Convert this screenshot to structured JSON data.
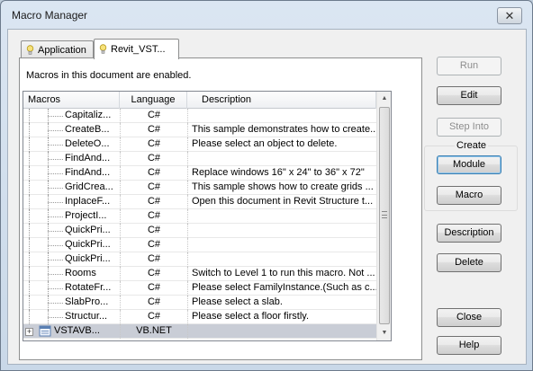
{
  "window": {
    "title": "Macro Manager",
    "close_glyph": "✕"
  },
  "tabs": [
    {
      "label": "Application",
      "icon": "lightbulb-icon",
      "selected": false
    },
    {
      "label": "Revit_VST...",
      "icon": "lightbulb-icon",
      "selected": true
    }
  ],
  "panel": {
    "status_message": "Macros in this document are enabled."
  },
  "grid": {
    "columns": [
      "Macros",
      "Language",
      "Description"
    ],
    "rows": [
      {
        "name": "Capitaliz...",
        "language": "C#",
        "description": ""
      },
      {
        "name": "CreateB...",
        "language": "C#",
        "description": "This sample demonstrates how to create..."
      },
      {
        "name": "DeleteO...",
        "language": "C#",
        "description": "Please select an object to delete."
      },
      {
        "name": "FindAnd...",
        "language": "C#",
        "description": ""
      },
      {
        "name": "FindAnd...",
        "language": "C#",
        "description": "Replace windows 16\" x 24\" to 36\" x 72\""
      },
      {
        "name": "GridCrea...",
        "language": "C#",
        "description": "This sample shows how to create grids ..."
      },
      {
        "name": "InplaceF...",
        "language": "C#",
        "description": "Open this document in Revit Structure t..."
      },
      {
        "name": "ProjectI...",
        "language": "C#",
        "description": ""
      },
      {
        "name": "QuickPri...",
        "language": "C#",
        "description": ""
      },
      {
        "name": "QuickPri...",
        "language": "C#",
        "description": ""
      },
      {
        "name": "QuickPri...",
        "language": "C#",
        "description": ""
      },
      {
        "name": "Rooms",
        "language": "C#",
        "description": "Switch to Level 1 to run this macro. Not ..."
      },
      {
        "name": "RotateFr...",
        "language": "C#",
        "description": "Please select FamilyInstance.(Such as c..."
      },
      {
        "name": "SlabPro...",
        "language": "C#",
        "description": "Please select a slab."
      },
      {
        "name": "Structur...",
        "language": "C#",
        "description": "Please select a floor firstly."
      }
    ],
    "module_row": {
      "name": "VSTAVB...",
      "language": "VB.NET",
      "description": "",
      "selected": true
    }
  },
  "buttons": {
    "run": "Run",
    "edit": "Edit",
    "step_into": "Step Into",
    "create_group_label": "Create",
    "module": "Module",
    "macro": "Macro",
    "description": "Description",
    "delete": "Delete",
    "close": "Close",
    "help": "Help"
  },
  "colors": {
    "selection": "#c9cdd6",
    "focus_border": "#3c7fb1"
  }
}
